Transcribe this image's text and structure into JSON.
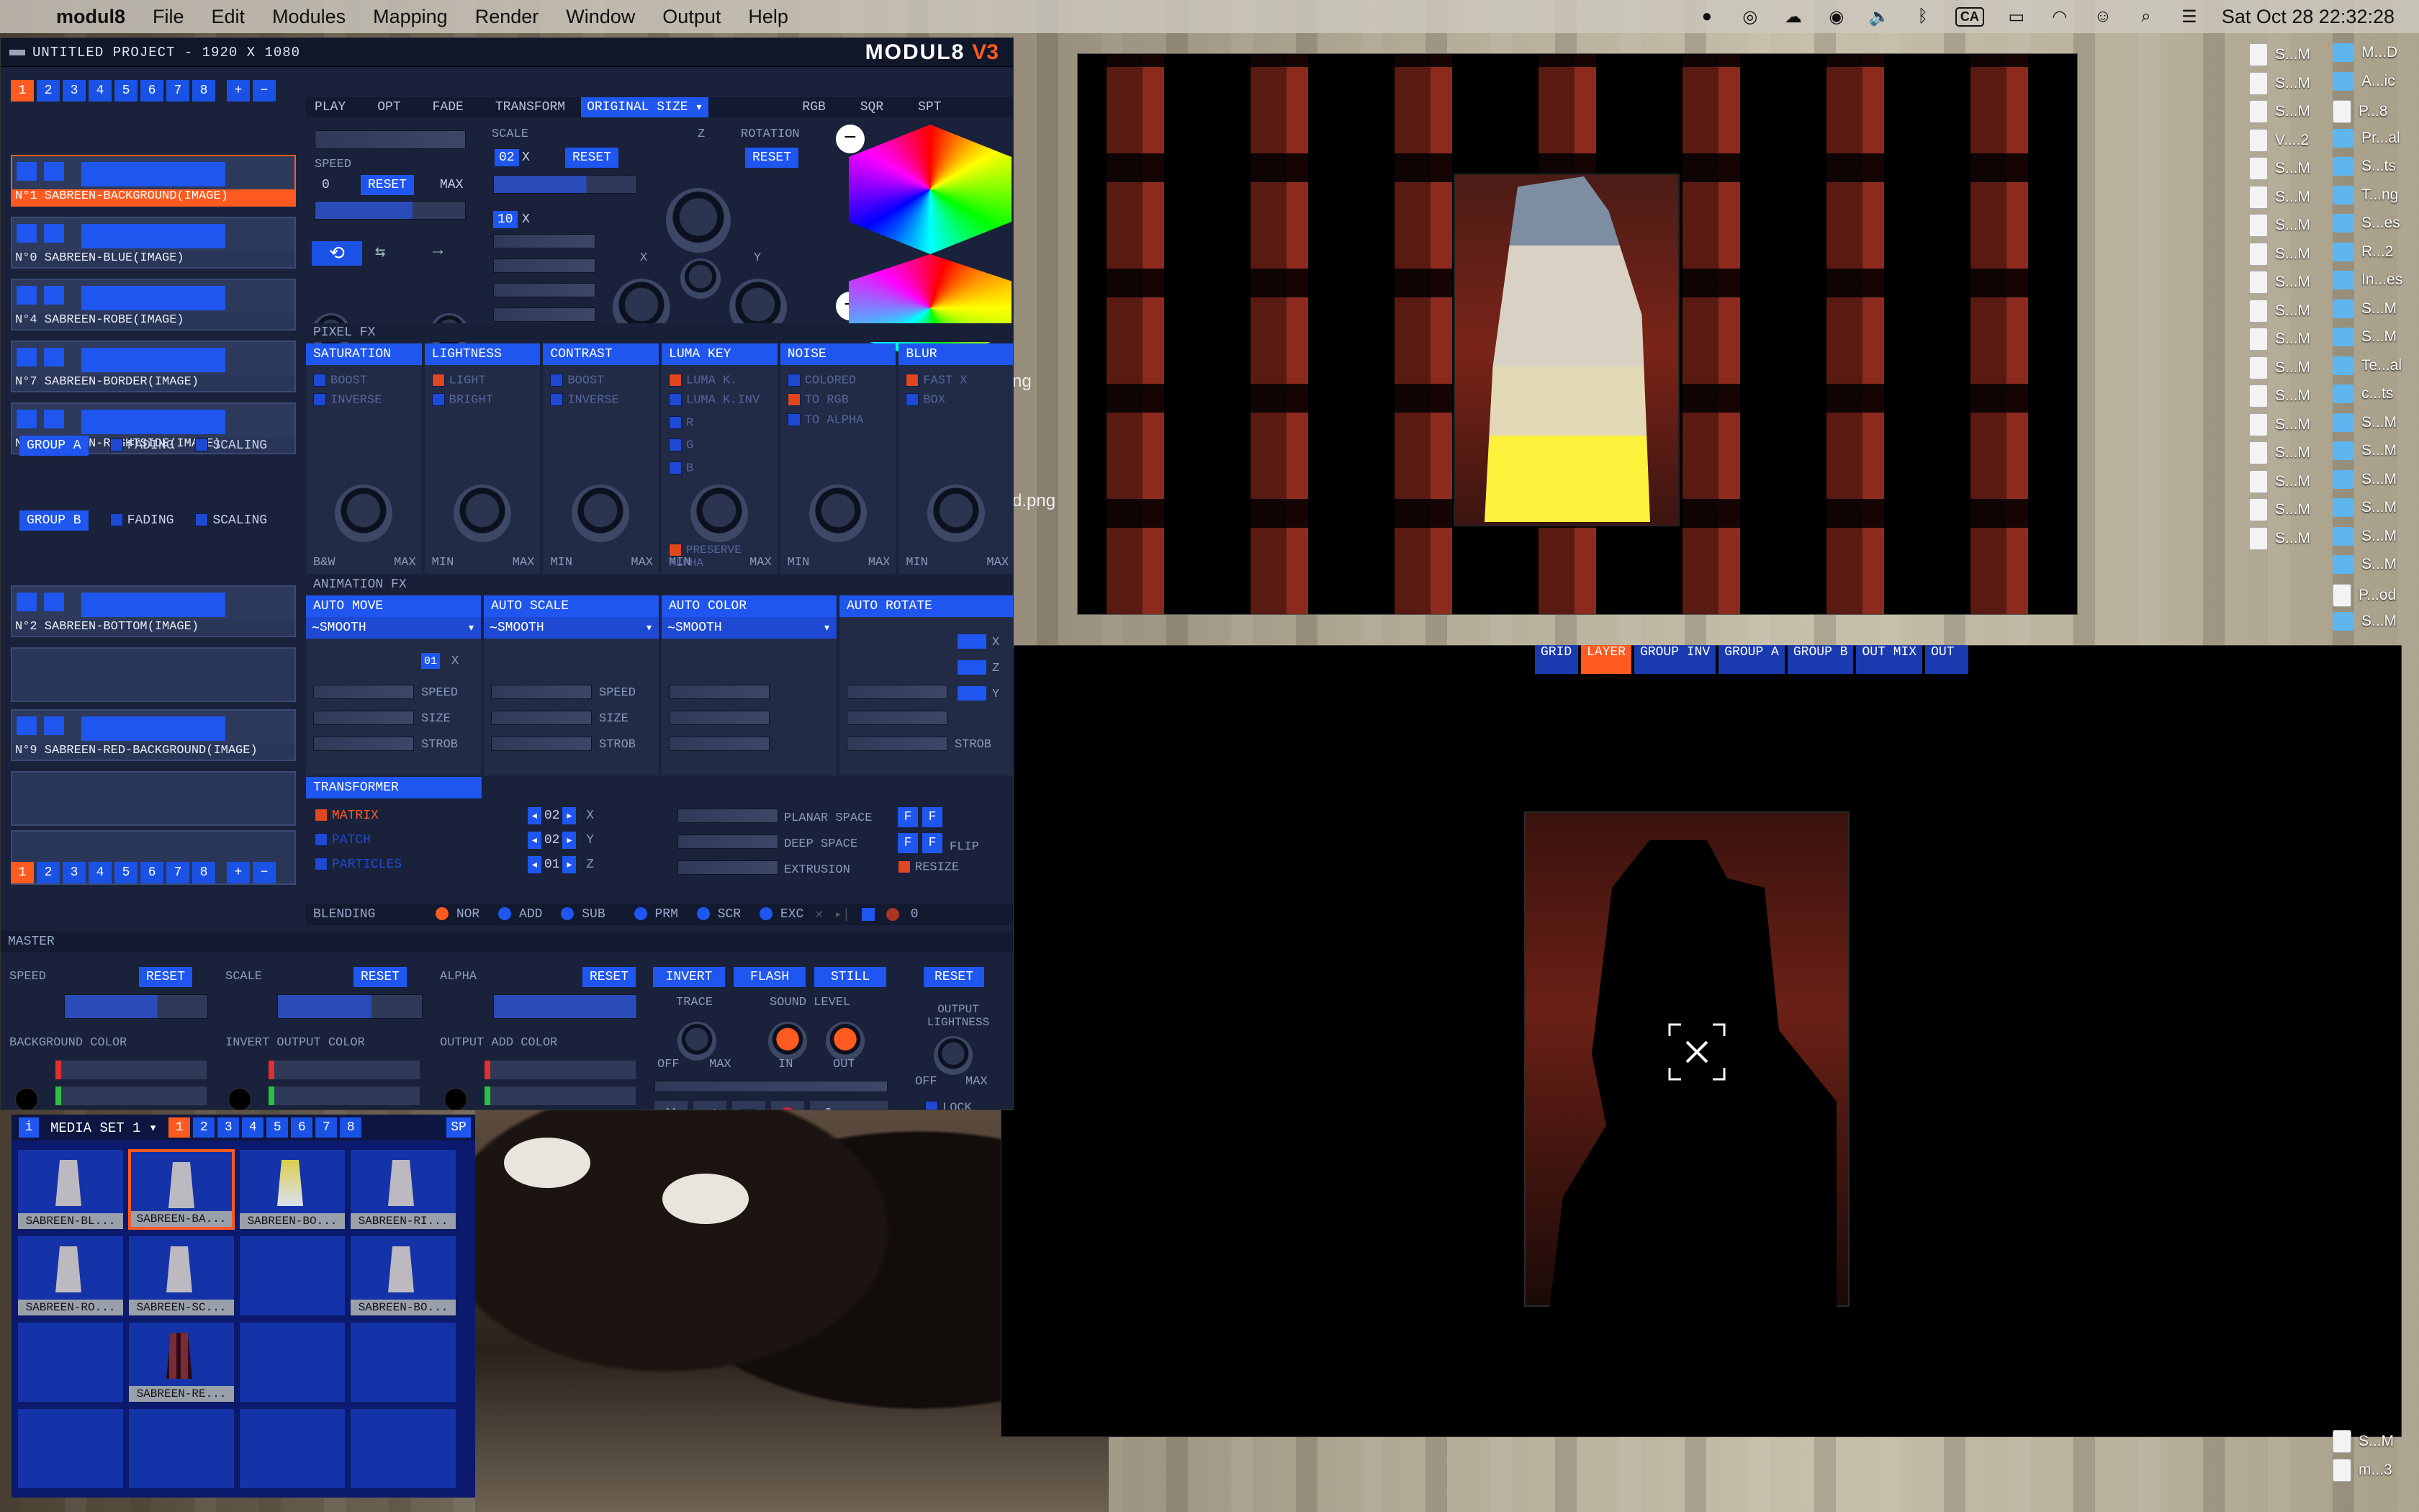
{
  "menubar": {
    "app": "modul8",
    "menus": [
      "File",
      "Edit",
      "Modules",
      "Mapping",
      "Render",
      "Window",
      "Output",
      "Help"
    ],
    "ca": "CA",
    "datetime": "Sat Oct 28  22:32:28"
  },
  "window": {
    "project": "UNTITLED PROJECT - 1920 X 1080",
    "logo": "MODUL8",
    "version": "V3"
  },
  "layer_tabs": [
    "1",
    "2",
    "3",
    "4",
    "5",
    "6",
    "7",
    "8"
  ],
  "layers": [
    {
      "name": "N°1 SABREEN-BACKGROUND(IMAGE)",
      "selected": true
    },
    {
      "name": "N°0 SABREEN-BLUE(IMAGE)"
    },
    {
      "name": "N°4 SABREEN-ROBE(IMAGE)"
    },
    {
      "name": "N°7 SABREEN-BORDER(IMAGE)"
    },
    {
      "name": "N°3 SABREEN-RIGHTSIDE(IMAGE)"
    },
    {
      "name": "N°2 SABREEN-BOTTOM(IMAGE)"
    },
    {
      "name": "N°9 SABREEN-RED-BACKGROUND(IMAGE)"
    }
  ],
  "groups": [
    {
      "label": "GROUP A",
      "fading": "FADING",
      "scaling": "SCALING"
    },
    {
      "label": "GROUP B",
      "fading": "FADING",
      "scaling": "SCALING"
    }
  ],
  "tabs": {
    "play": "PLAY",
    "opt": "OPT",
    "fade": "FADE",
    "transform": "TRANSFORM",
    "size": "ORIGINAL SIZE",
    "rgb": "RGB",
    "sqr": "SQR",
    "spt": "SPT"
  },
  "play": {
    "speed": "SPEED",
    "zero": "0",
    "reset": "RESET",
    "max": "MAX"
  },
  "transform": {
    "scale": "SCALE",
    "z": "Z",
    "rotation": "ROTATION",
    "reset": "RESET",
    "scale_val": "02",
    "x": "X",
    "y": "Y",
    "val10": "10"
  },
  "pixel_fx": {
    "title": "PIXEL FX",
    "cols": [
      {
        "h": "SATURATION",
        "a": "BOOST",
        "b": "INVERSE",
        "lo": "B&W",
        "hi": "MAX"
      },
      {
        "h": "LIGHTNESS",
        "a": "LIGHT",
        "b": "BRIGHT",
        "lo": "MIN",
        "hi": "MAX"
      },
      {
        "h": "CONTRAST",
        "a": "BOOST",
        "b": "INVERSE",
        "lo": "MIN",
        "hi": "MAX"
      },
      {
        "h": "LUMA KEY",
        "a": "LUMA K.",
        "b": "LUMA K.INV",
        "lo": "MIN",
        "hi": "MAX"
      },
      {
        "h": "NOISE",
        "a": "COLORED",
        "b": "TO RGB",
        "lo": "MIN",
        "hi": "MAX"
      },
      {
        "h": "BLUR",
        "a": "FAST X",
        "b": "BOX",
        "lo": "MIN",
        "hi": "MAX"
      }
    ],
    "rgb": [
      "R",
      "G",
      "B"
    ],
    "preserve": "PRESERVE ALPHA",
    "toalpha": "TO ALPHA"
  },
  "anim_fx": {
    "title": "ANIMATION FX",
    "cols": [
      {
        "h": "AUTO MOVE",
        "mode": "SMOOTH"
      },
      {
        "h": "AUTO SCALE",
        "mode": "SMOOTH"
      },
      {
        "h": "AUTO COLOR",
        "mode": "SMOOTH"
      },
      {
        "h": "AUTO ROTATE"
      }
    ],
    "speed": "SPEED",
    "size": "SIZE",
    "strob": "STROB",
    "x": "X",
    "y": "Y",
    "z": "Z",
    "val": "01"
  },
  "transformer": {
    "title": "TRANSFORMER",
    "matrix": "MATRIX",
    "patch": "PATCH",
    "particles": "PARTICLES",
    "v1": "02",
    "v2": "02",
    "v3": "01",
    "x": "X",
    "y": "Y",
    "z": "Z",
    "planar": "PLANAR SPACE",
    "deep": "DEEP SPACE",
    "extrusion": "EXTRUSION",
    "f": "F",
    "flip": "FLIP",
    "resize": "RESIZE"
  },
  "blending": {
    "label": "BLENDING",
    "modes": [
      "NOR",
      "ADD",
      "SUB",
      "PRM",
      "SCR",
      "EXC"
    ],
    "val": "0"
  },
  "master": {
    "title": "MASTER",
    "speed": "SPEED",
    "scale": "SCALE",
    "alpha": "ALPHA",
    "reset": "RESET",
    "invert": "INVERT",
    "flash": "FLASH",
    "still": "STILL",
    "trace": "TRACE",
    "sound": "SOUND LEVEL",
    "off": "OFF",
    "max": "MAX",
    "in": "IN",
    "out": "OUT",
    "outl": "OUTPUT LIGHTNESS",
    "lock": "LOCK",
    "bg": "BACKGROUND COLOR",
    "inv": "INVERT OUTPUT COLOR",
    "add": "OUTPUT ADD COLOR",
    "zero": "0"
  },
  "media": {
    "info": "i",
    "set": "MEDIA SET 1",
    "sp": "SP",
    "tabs": [
      "1",
      "2",
      "3",
      "4",
      "5",
      "6",
      "7",
      "8"
    ],
    "items": [
      "SABREEN-BL...",
      "SABREEN-BA...",
      "SABREEN-BO...",
      "SABREEN-RI...",
      "SABREEN-RO...",
      "SABREEN-SC...",
      "",
      "SABREEN-BO...",
      "",
      "SABREEN-RE..."
    ]
  },
  "output_tabs": [
    "GRID",
    "LAYER",
    "GROUP INV",
    "GROUP A",
    "GROUP B",
    "OUT MIX",
    "OUT"
  ],
  "bg_text": {
    "a": "ng",
    "b": "d.png"
  },
  "desktop": {
    "left": [
      "S...M",
      "S...M",
      "S...M",
      "V....2",
      "S...M",
      "S...M",
      "S...M",
      "S...M",
      "S...M",
      "S...M",
      "S...M",
      "S...M",
      "S...M",
      "S...M",
      "S...M",
      "S...M",
      "S...M",
      "S...M"
    ],
    "right": [
      "M...D",
      "A...ic",
      "P...8",
      "Pr...al",
      "S...ts",
      "T...ng",
      "S...es",
      "R...2",
      "In...es",
      "S...M",
      "S...M",
      "Te...al",
      "c...ts",
      "S...M",
      "S...M",
      "S...M",
      "S...M",
      "S...M",
      "S...M",
      "P...od",
      "S...M"
    ],
    "bottom": [
      "S...M",
      "m...3"
    ]
  }
}
